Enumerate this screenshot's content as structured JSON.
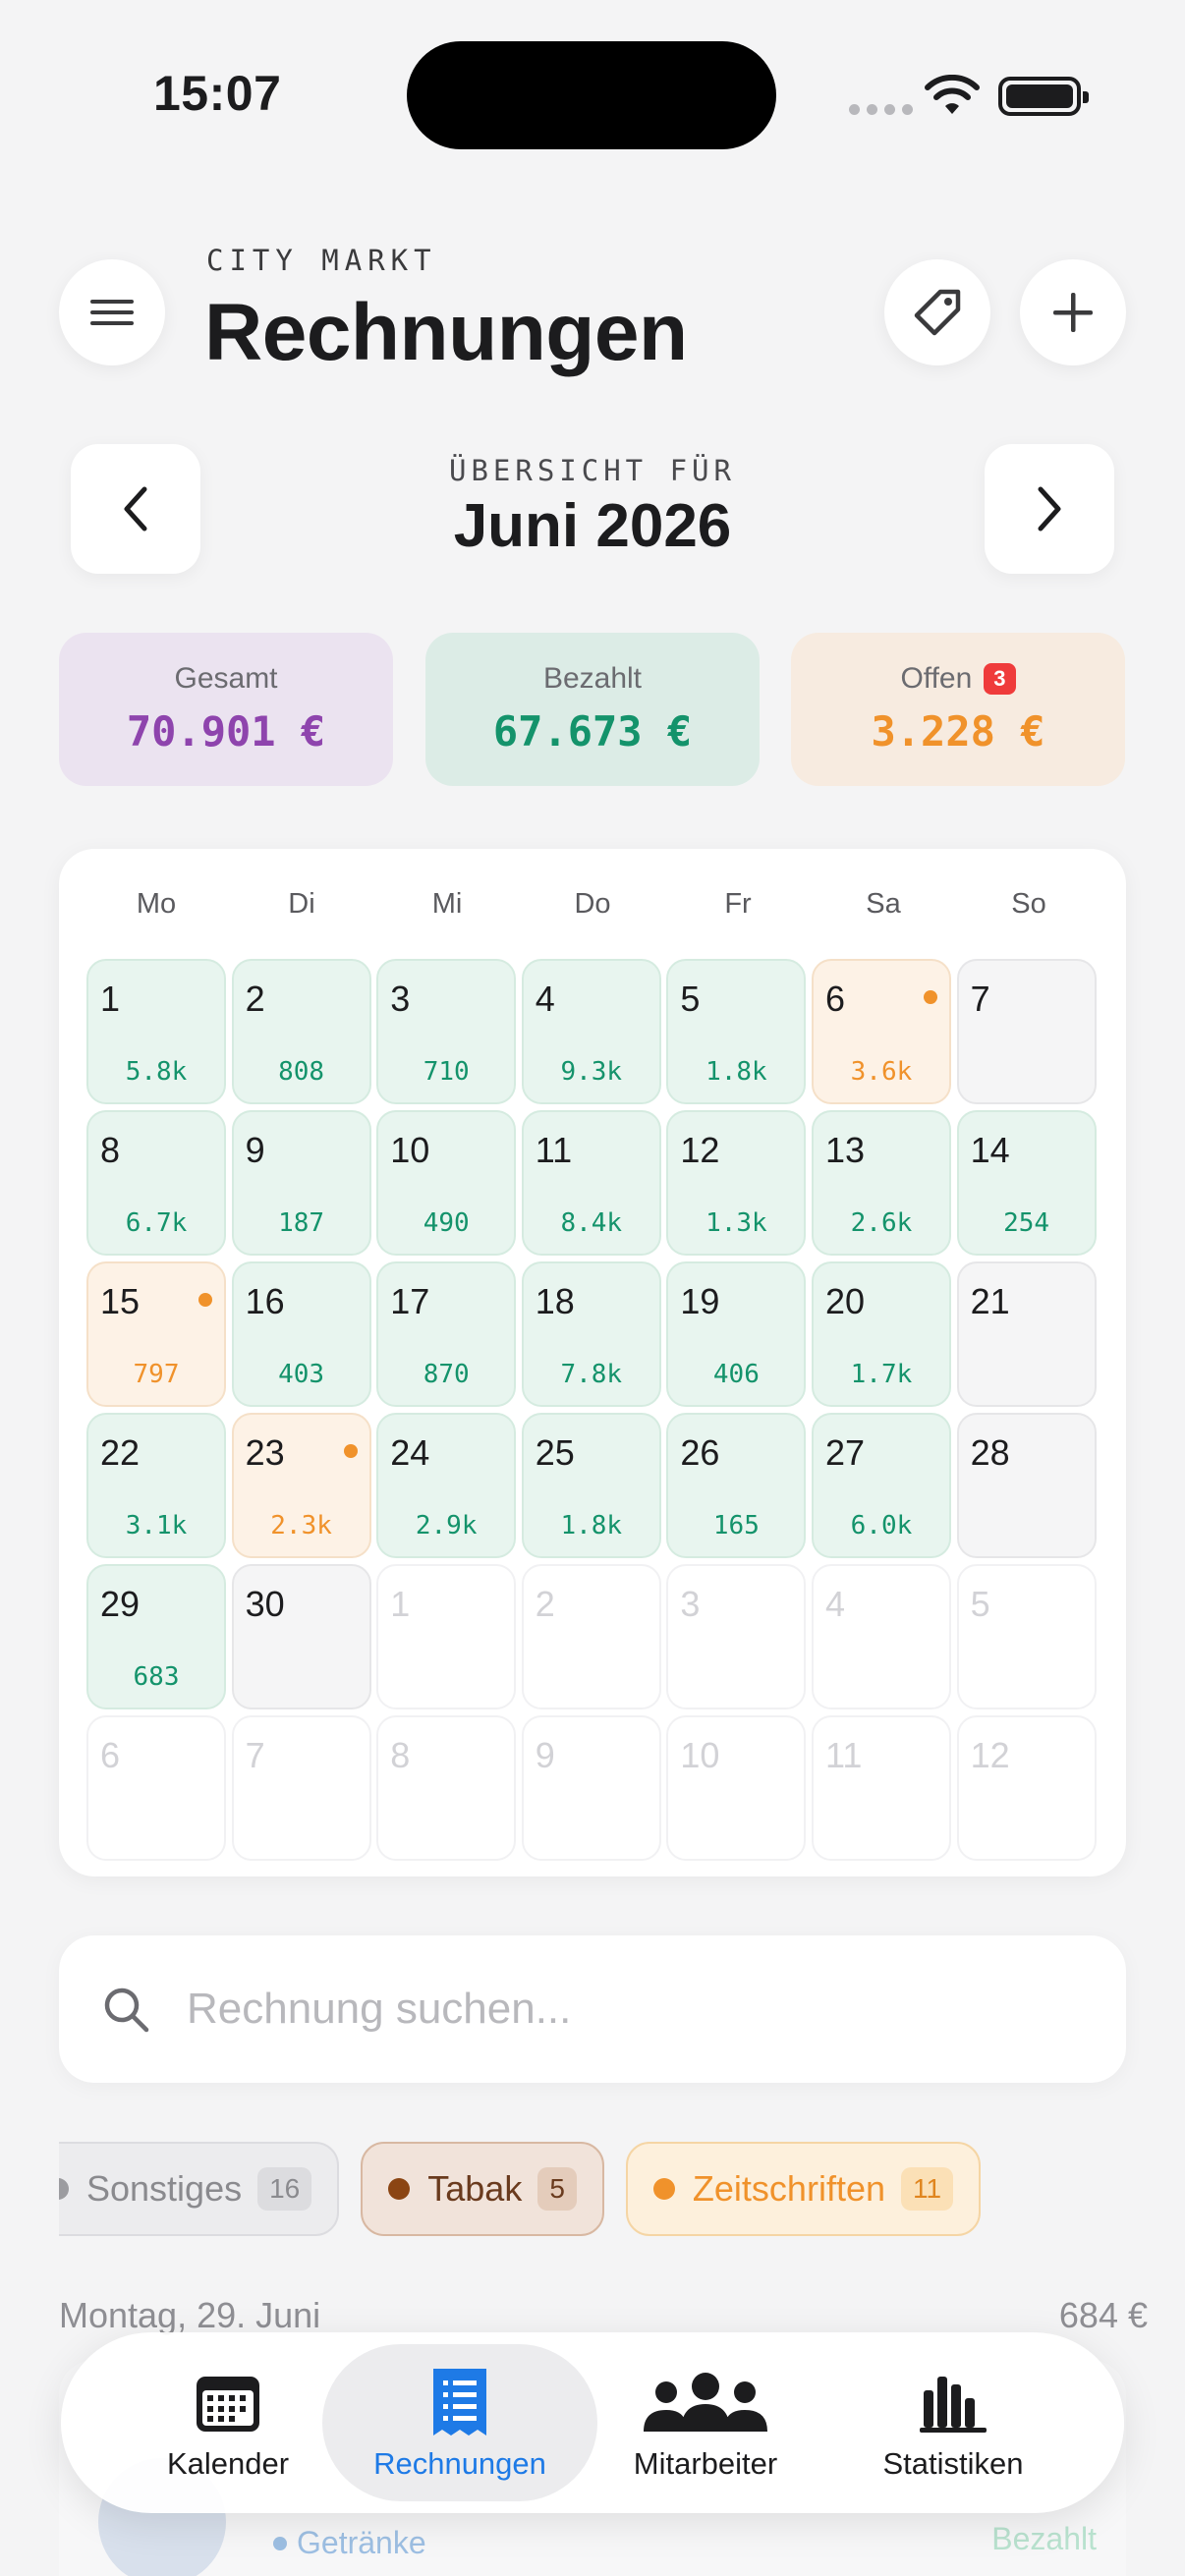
{
  "status_bar": {
    "time": "15:07"
  },
  "header": {
    "store": "CITY MARKT",
    "title": "Rechnungen"
  },
  "month_nav": {
    "overview_label": "ÜBERSICHT FÜR",
    "month": "Juni 2026"
  },
  "summary": {
    "total_label": "Gesamt",
    "total_value": "70.901 €",
    "paid_label": "Bezahlt",
    "paid_value": "67.673 €",
    "open_label": "Offen",
    "open_count": "3",
    "open_value": "3.228 €"
  },
  "calendar": {
    "weekdays": [
      "Mo",
      "Di",
      "Mi",
      "Do",
      "Fr",
      "Sa",
      "So"
    ],
    "days": [
      {
        "d": "1",
        "a": "5.8k",
        "s": "paid"
      },
      {
        "d": "2",
        "a": "808",
        "s": "paid"
      },
      {
        "d": "3",
        "a": "710",
        "s": "paid"
      },
      {
        "d": "4",
        "a": "9.3k",
        "s": "paid"
      },
      {
        "d": "5",
        "a": "1.8k",
        "s": "paid"
      },
      {
        "d": "6",
        "a": "3.6k",
        "s": "open"
      },
      {
        "d": "7",
        "a": "",
        "s": "empty"
      },
      {
        "d": "8",
        "a": "6.7k",
        "s": "paid"
      },
      {
        "d": "9",
        "a": "187",
        "s": "paid"
      },
      {
        "d": "10",
        "a": "490",
        "s": "paid"
      },
      {
        "d": "11",
        "a": "8.4k",
        "s": "paid"
      },
      {
        "d": "12",
        "a": "1.3k",
        "s": "paid"
      },
      {
        "d": "13",
        "a": "2.6k",
        "s": "paid"
      },
      {
        "d": "14",
        "a": "254",
        "s": "paid"
      },
      {
        "d": "15",
        "a": "797",
        "s": "open"
      },
      {
        "d": "16",
        "a": "403",
        "s": "paid"
      },
      {
        "d": "17",
        "a": "870",
        "s": "paid"
      },
      {
        "d": "18",
        "a": "7.8k",
        "s": "paid"
      },
      {
        "d": "19",
        "a": "406",
        "s": "paid"
      },
      {
        "d": "20",
        "a": "1.7k",
        "s": "paid"
      },
      {
        "d": "21",
        "a": "",
        "s": "empty"
      },
      {
        "d": "22",
        "a": "3.1k",
        "s": "paid"
      },
      {
        "d": "23",
        "a": "2.3k",
        "s": "open"
      },
      {
        "d": "24",
        "a": "2.9k",
        "s": "paid"
      },
      {
        "d": "25",
        "a": "1.8k",
        "s": "paid"
      },
      {
        "d": "26",
        "a": "165",
        "s": "paid"
      },
      {
        "d": "27",
        "a": "6.0k",
        "s": "paid"
      },
      {
        "d": "28",
        "a": "",
        "s": "empty"
      },
      {
        "d": "29",
        "a": "683",
        "s": "paid"
      },
      {
        "d": "30",
        "a": "",
        "s": "empty"
      },
      {
        "d": "1",
        "a": "",
        "s": "other"
      },
      {
        "d": "2",
        "a": "",
        "s": "other"
      },
      {
        "d": "3",
        "a": "",
        "s": "other"
      },
      {
        "d": "4",
        "a": "",
        "s": "other"
      },
      {
        "d": "5",
        "a": "",
        "s": "other"
      },
      {
        "d": "6",
        "a": "",
        "s": "other"
      },
      {
        "d": "7",
        "a": "",
        "s": "other"
      },
      {
        "d": "8",
        "a": "",
        "s": "other"
      },
      {
        "d": "9",
        "a": "",
        "s": "other"
      },
      {
        "d": "10",
        "a": "",
        "s": "other"
      },
      {
        "d": "11",
        "a": "",
        "s": "other"
      },
      {
        "d": "12",
        "a": "",
        "s": "other"
      }
    ]
  },
  "search": {
    "placeholder": "Rechnung suchen..."
  },
  "categories": [
    {
      "label": "Sonstiges",
      "count": "16",
      "style": "chip-sonst"
    },
    {
      "label": "Tabak",
      "count": "5",
      "style": "chip-tabak"
    },
    {
      "label": "Zeitschriften",
      "count": "11",
      "style": "chip-zeit"
    }
  ],
  "day_group": {
    "label": "Montag, 29. Juni",
    "total": "684 €"
  },
  "list_preview": {
    "category": "Getränke",
    "status": "Bezahlt"
  },
  "tabs": {
    "calendar": "Kalender",
    "invoices": "Rechnungen",
    "staff": "Mitarbeiter",
    "stats": "Statistiken"
  },
  "colors": {
    "accent": "#1e7ae6",
    "paid": "#14936b",
    "open": "#f0922b",
    "total": "#8e44ad"
  }
}
